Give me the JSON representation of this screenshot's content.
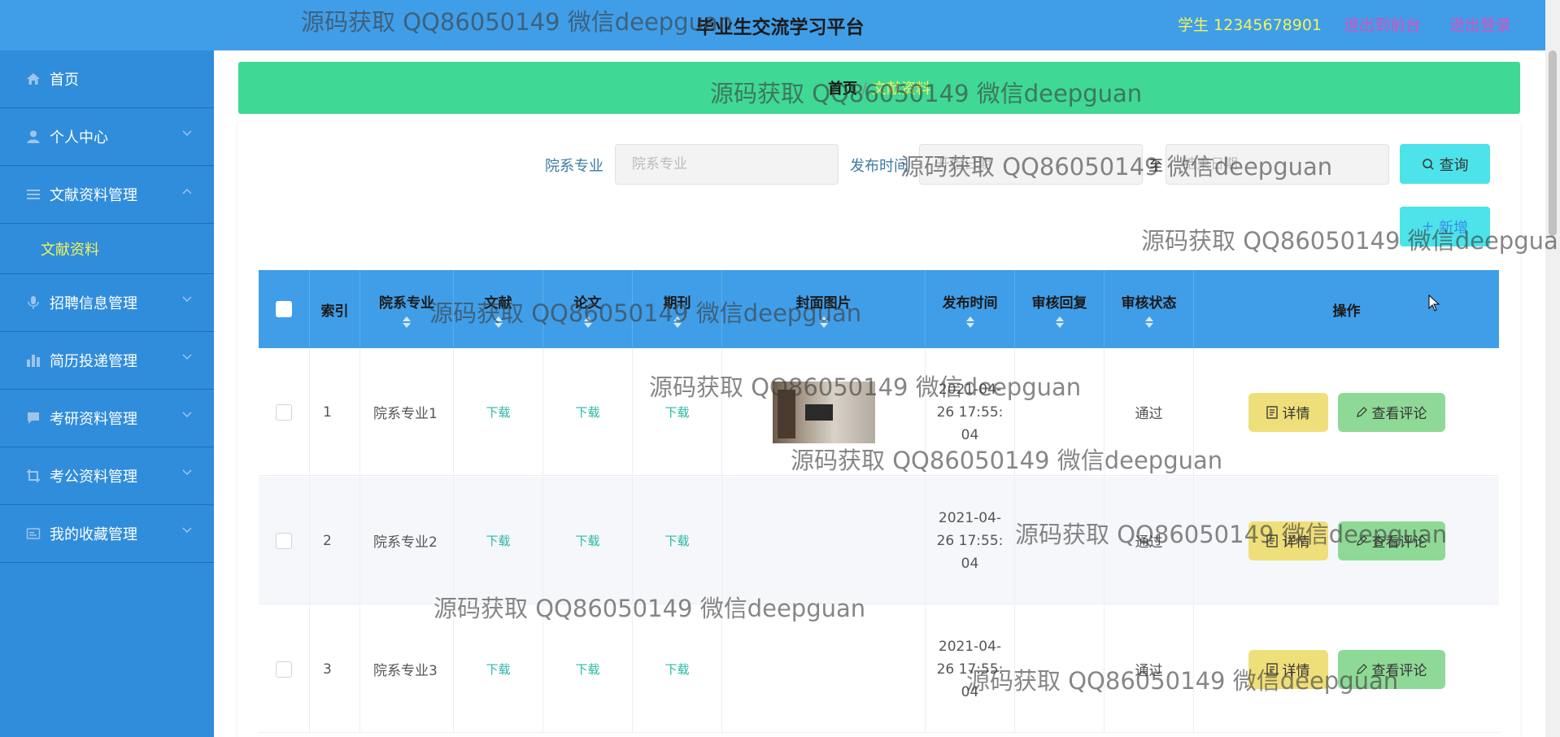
{
  "header": {
    "title": "毕业生交流学习平台",
    "user": "学生 12345678901",
    "to_front": "退出到前台",
    "logout": "退出登录"
  },
  "sidebar": {
    "items": [
      {
        "label": "首页",
        "icon": "home-icon"
      },
      {
        "label": "个人中心",
        "icon": "user-icon"
      },
      {
        "label": "文献资料管理",
        "icon": "list-icon",
        "expanded": true
      },
      {
        "label": "文献资料",
        "sub": true
      },
      {
        "label": "招聘信息管理",
        "icon": "mic-icon"
      },
      {
        "label": "简历投递管理",
        "icon": "bar-chart-icon"
      },
      {
        "label": "考研资料管理",
        "icon": "chat-icon"
      },
      {
        "label": "考公资料管理",
        "icon": "crop-icon"
      },
      {
        "label": "我的收藏管理",
        "icon": "card-icon"
      }
    ]
  },
  "breadcrumb": {
    "home": "首页",
    "separator": "/",
    "current": "文献资料"
  },
  "search": {
    "dept_label": "院系专业",
    "dept_placeholder": "院系专业",
    "time_label": "发布时间",
    "start_placeholder": "开始日期",
    "to": "至",
    "end_placeholder": "结束日期",
    "query_button": "查询",
    "add_button": "新增"
  },
  "table": {
    "headers": [
      "索引",
      "院系专业",
      "文献",
      "论文",
      "期刊",
      "封面图片",
      "发布时间",
      "审核回复",
      "审核状态",
      "操作"
    ],
    "rows": [
      {
        "index": "1",
        "dept": "院系专业1",
        "doc": "下载",
        "thesis": "下载",
        "journal": "下载",
        "time1": "2021-04-",
        "time2": "26 17:55:",
        "time3": "04",
        "reply": "",
        "status": "通过",
        "detail": "详情",
        "review": "查看评论"
      },
      {
        "index": "2",
        "dept": "院系专业2",
        "doc": "下载",
        "thesis": "下载",
        "journal": "下载",
        "time1": "2021-04-",
        "time2": "26 17:55:",
        "time3": "04",
        "reply": "",
        "status": "通过",
        "detail": "详情",
        "review": "查看评论"
      },
      {
        "index": "3",
        "dept": "院系专业3",
        "doc": "下载",
        "thesis": "下载",
        "journal": "下载",
        "time1": "2021-04-",
        "time2": "26 17:55:",
        "time3": "04",
        "reply": "",
        "status": "通过",
        "detail": "详情",
        "review": "查看评论"
      }
    ]
  },
  "watermark": "源码获取 QQ86050149 微信deepguan",
  "colors": {
    "header": "#409ee8",
    "sidebar": "#308ddc",
    "breadcrumb": "#3fd895",
    "highlight": "#f3f35a",
    "link": "#d94fbf"
  }
}
